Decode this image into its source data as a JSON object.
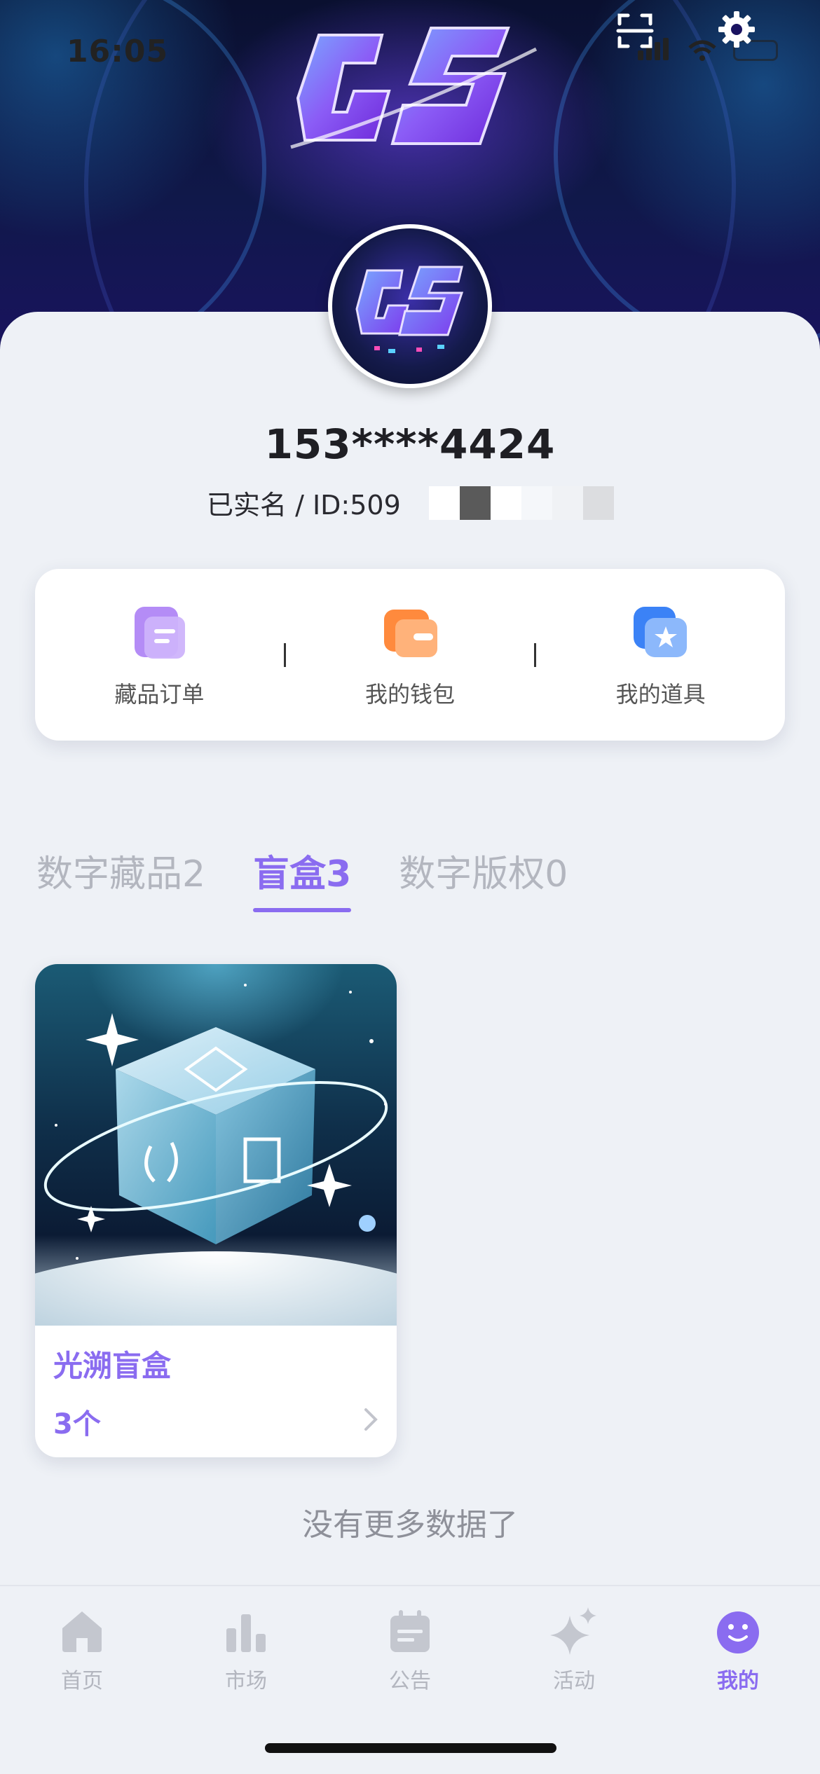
{
  "status_bar": {
    "time": "16:05"
  },
  "header": {
    "scan_icon": "scan-icon",
    "settings_icon": "gear-icon",
    "brand_logo_text": "GS"
  },
  "profile": {
    "phone_masked": "153****4424",
    "verify_prefix": "已实名 / ID:509"
  },
  "quick_actions": [
    {
      "label": "藏品订单",
      "icon": "order-doc-icon",
      "color": "#a77cf2"
    },
    {
      "label": "我的钱包",
      "icon": "wallet-icon",
      "color": "#ff8a3d"
    },
    {
      "label": "我的道具",
      "icon": "props-star-icon",
      "color": "#4a8ff5"
    }
  ],
  "tabs": [
    {
      "label": "数字藏品2"
    },
    {
      "label": "盲盒3"
    },
    {
      "label": "数字版权0"
    }
  ],
  "active_tab": 1,
  "items": [
    {
      "title": "光溯盲盒",
      "count": "3个"
    }
  ],
  "list_end_text": "没有更多数据了",
  "bottom_nav": [
    {
      "label": "首页",
      "icon": "home-icon"
    },
    {
      "label": "市场",
      "icon": "bar-chart-icon"
    },
    {
      "label": "公告",
      "icon": "calendar-icon"
    },
    {
      "label": "活动",
      "icon": "sparkle-icon"
    },
    {
      "label": "我的",
      "icon": "smiley-icon"
    }
  ],
  "active_nav": 4,
  "colors": {
    "accent": "#8a6cf0",
    "muted": "#b3b6bf",
    "background": "#eef1f6"
  }
}
